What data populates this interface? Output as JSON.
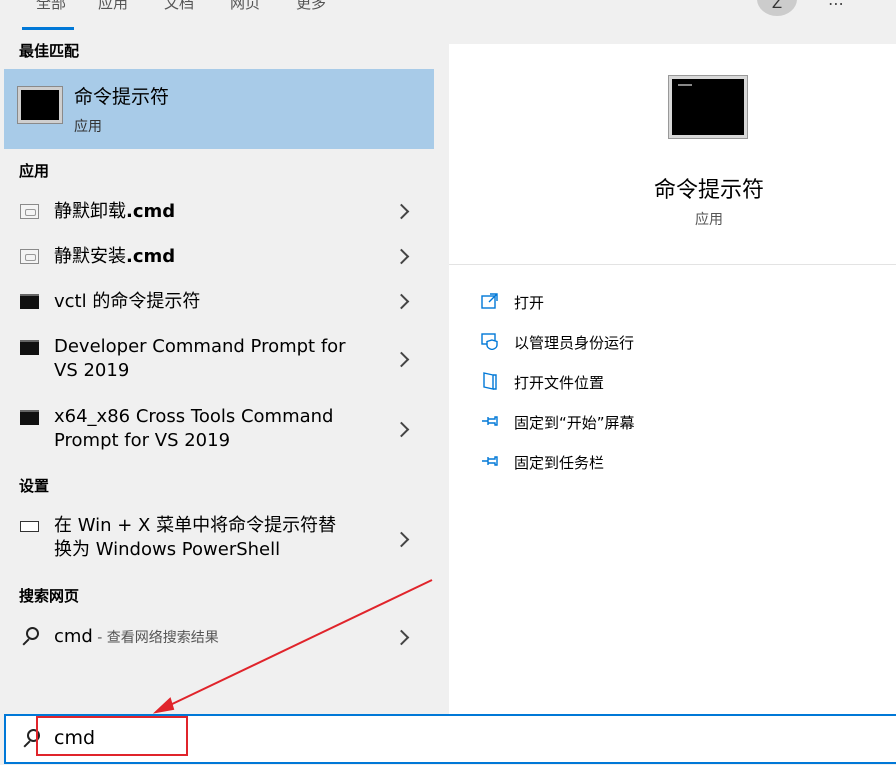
{
  "top_tabs": [
    "全部",
    "应用",
    "文档",
    "网页",
    "更多"
  ],
  "user_initial": "Z",
  "more_icon": "ellipsis-icon",
  "best_match": {
    "header": "最佳匹配",
    "title": "命令提示符",
    "subtitle": "应用"
  },
  "apps": {
    "header": "应用",
    "items": [
      {
        "name": "静默卸载",
        "ext": ".cmd",
        "icon": "script-file-icon"
      },
      {
        "name": "静默安装",
        "ext": ".cmd",
        "icon": "script-file-icon"
      },
      {
        "name": "vctl 的命令提示符",
        "icon": "console-icon"
      },
      {
        "line1": "Developer Command Prompt for",
        "line2": "VS 2019",
        "icon": "console-icon"
      },
      {
        "line1": "x64_x86 Cross Tools Command",
        "line2": "Prompt for VS 2019",
        "icon": "console-icon"
      }
    ]
  },
  "settings": {
    "header": "设置",
    "line1": "在 Win + X 菜单中将命令提示符替",
    "line2": "换为 Windows PowerShell",
    "icon": "monitor-icon"
  },
  "web": {
    "header": "搜索网页",
    "query": "cmd",
    "suffix": " - 查看网络搜索结果"
  },
  "detail": {
    "title": "命令提示符",
    "subtitle": "应用",
    "actions": [
      {
        "label": "打开",
        "icon": "open-icon"
      },
      {
        "label": "以管理员身份运行",
        "icon": "shield-icon"
      },
      {
        "label": "打开文件位置",
        "icon": "folder-location-icon"
      },
      {
        "label": "固定到“开始”屏幕",
        "icon": "pin-icon"
      },
      {
        "label": "固定到任务栏",
        "icon": "pin-icon"
      }
    ]
  },
  "search": {
    "value": "cmd"
  },
  "colors": {
    "accent": "#0078d7",
    "selection": "#a8cbe8",
    "annotation": "#e0242b"
  }
}
